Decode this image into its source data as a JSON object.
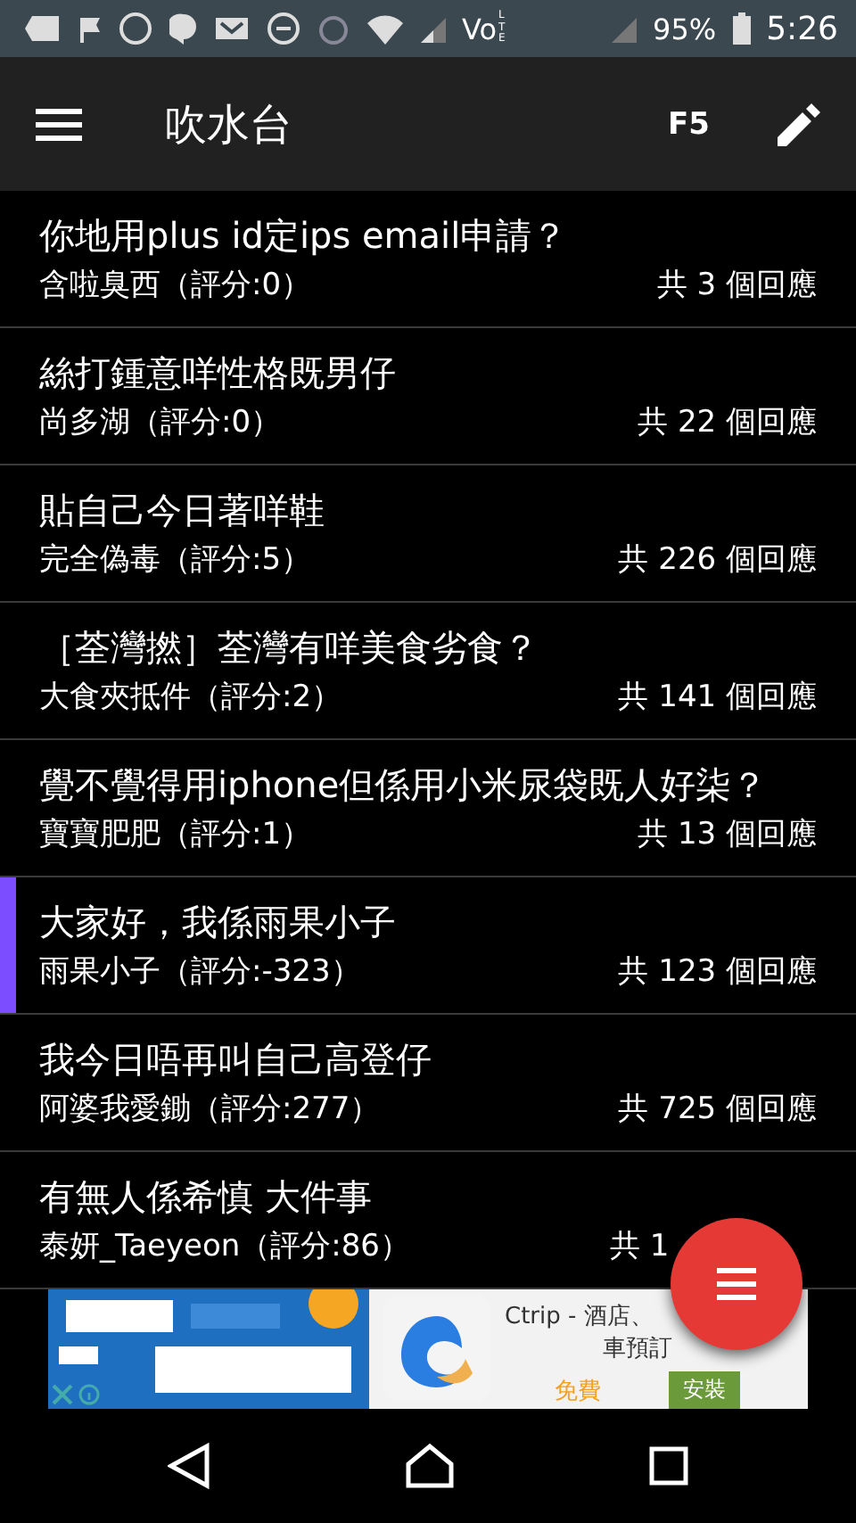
{
  "status_bar": {
    "battery": "95%",
    "time": "5:26",
    "network": [
      "Vo",
      "LTE"
    ]
  },
  "app_bar": {
    "title": "吹水台",
    "action": "F5"
  },
  "threads": [
    {
      "title": "你地用plus id定ips email申請？",
      "author": "含啦臭西（評分:0）",
      "replies": "共 3 個回應",
      "selected": false
    },
    {
      "title": "絲打鍾意咩性格既男仔",
      "author": "尚多湖（評分:0）",
      "replies": "共 22 個回應",
      "selected": false
    },
    {
      "title": "貼自己今日著咩鞋",
      "author": "完全偽毒（評分:5）",
      "replies": "共 226 個回應",
      "selected": false
    },
    {
      "title": "［荃灣撚］荃灣有咩美食劣食？",
      "author": "大食夾抵件（評分:2）",
      "replies": "共 141 個回應",
      "selected": false
    },
    {
      "title": "覺不覺得用iphone但係用小米尿袋既人好柒？",
      "author": "寶寶肥肥（評分:1）",
      "replies": "共 13 個回應",
      "selected": false
    },
    {
      "title": "大家好，我係雨果小子",
      "author": "雨果小子（評分:-323）",
      "replies": "共 123 個回應",
      "selected": true
    },
    {
      "title": "我今日唔再叫自己高登仔",
      "author": "阿婆我愛鋤（評分:277）",
      "replies": "共 725 個回應",
      "selected": false
    },
    {
      "title": "有無人係希慎 大件事",
      "author": "泰妍_Taeyeon（評分:86）",
      "replies": "共 1",
      "selected": false
    }
  ],
  "ad": {
    "app_name": "Ctrip - 酒店、",
    "app_name_2": "車預訂",
    "price": "免費",
    "install": "安裝"
  }
}
